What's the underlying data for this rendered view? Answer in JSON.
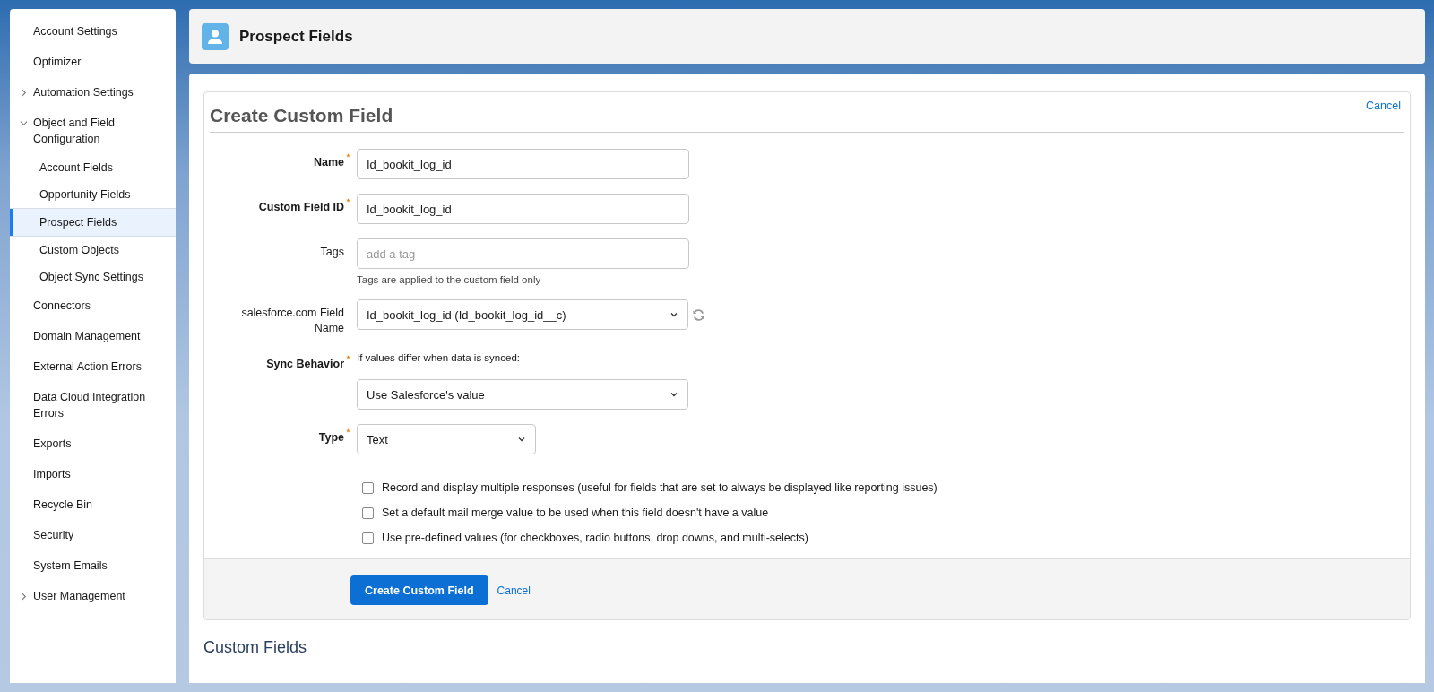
{
  "sidebar": {
    "items": [
      {
        "label": "Account Settings",
        "selected": false
      },
      {
        "label": "Optimizer",
        "selected": false
      },
      {
        "label": "Automation Settings",
        "selected": false,
        "expanded": false
      },
      {
        "label": "Object and Field Configuration",
        "selected": false,
        "expanded": true,
        "children": [
          {
            "label": "Account Fields",
            "selected": false
          },
          {
            "label": "Opportunity Fields",
            "selected": false
          },
          {
            "label": "Prospect Fields",
            "selected": true
          },
          {
            "label": "Custom Objects",
            "selected": false
          },
          {
            "label": "Object Sync Settings",
            "selected": false
          }
        ]
      },
      {
        "label": "Connectors",
        "selected": false
      },
      {
        "label": "Domain Management",
        "selected": false
      },
      {
        "label": "External Action Errors",
        "selected": false
      },
      {
        "label": "Data Cloud Integration Errors",
        "selected": false
      },
      {
        "label": "Exports",
        "selected": false
      },
      {
        "label": "Imports",
        "selected": false
      },
      {
        "label": "Recycle Bin",
        "selected": false
      },
      {
        "label": "Security",
        "selected": false
      },
      {
        "label": "System Emails",
        "selected": false
      },
      {
        "label": "User Management",
        "selected": false,
        "expanded": false
      }
    ]
  },
  "header": {
    "title": "Prospect Fields"
  },
  "form": {
    "title": "Create Custom Field",
    "cancel_link": "Cancel",
    "fields": [
      {
        "kind": "text",
        "label": "Name",
        "required": true,
        "value": "Id_bookit_log_id"
      },
      {
        "kind": "text",
        "label": "Custom Field ID",
        "required": true,
        "value": "Id_bookit_log_id"
      },
      {
        "kind": "tags",
        "label": "Tags",
        "required": false,
        "placeholder": "add a tag",
        "hint": "Tags are applied to the custom field only"
      },
      {
        "kind": "select-refresh",
        "label": "salesforce.com Field Name",
        "required": false,
        "value": "Id_bookit_log_id (Id_bookit_log_id__c)"
      },
      {
        "kind": "select-note",
        "label": "Sync Behavior",
        "required": true,
        "note": "If values differ when data is synced:",
        "value": "Use Salesforce's value"
      },
      {
        "kind": "select-narrow",
        "label": "Type",
        "required": true,
        "value": "Text"
      }
    ],
    "checkboxes": [
      {
        "label": "Record and display multiple responses (useful for fields that are set to always be displayed like reporting issues)",
        "checked": false
      },
      {
        "label": "Set a default mail merge value to be used when this field doesn't have a value",
        "checked": false
      },
      {
        "label": "Use pre-defined values (for checkboxes, radio buttons, drop downs, and multi-selects)",
        "checked": false
      }
    ],
    "submit_button": "Create Custom Field",
    "footer_cancel": "Cancel"
  },
  "section_title": "Custom Fields"
}
